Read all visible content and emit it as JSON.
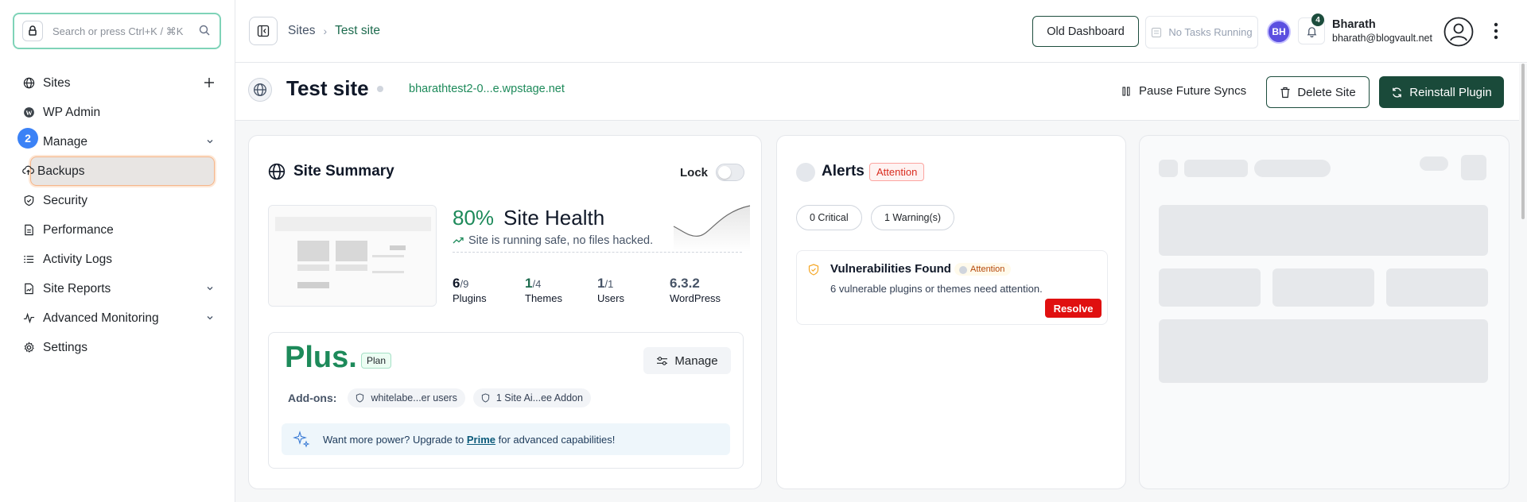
{
  "sidebar": {
    "search_placeholder": "Search or press Ctrl+K / ⌘K",
    "manage_step_badge": "2",
    "items": [
      {
        "label": "Sites",
        "icon": "globe-icon",
        "trail": "plus-icon"
      },
      {
        "label": "WP Admin",
        "icon": "wordpress-icon"
      },
      {
        "label": "Manage",
        "icon": "none",
        "trail": "chevron-down-icon"
      },
      {
        "label": "Backups",
        "icon": "cloud-upload-icon",
        "active": true
      },
      {
        "label": "Security",
        "icon": "shield-icon"
      },
      {
        "label": "Performance",
        "icon": "document-icon"
      },
      {
        "label": "Activity Logs",
        "icon": "list-icon"
      },
      {
        "label": "Site Reports",
        "icon": "file-report-icon",
        "trail": "chevron-down-icon"
      },
      {
        "label": "Advanced Monitoring",
        "icon": "pulse-icon",
        "trail": "chevron-down-icon"
      },
      {
        "label": "Settings",
        "icon": "gear-icon"
      }
    ]
  },
  "topbar": {
    "breadcrumb_root": "Sites",
    "breadcrumb_sep": "›",
    "breadcrumb_current": "Test site",
    "old_dashboard": "Old Dashboard",
    "tasks": "No Tasks Running",
    "avatar_initials": "BH",
    "notification_count": "4",
    "user_name": "Bharath",
    "user_email": "bharath@blogvault.net"
  },
  "site": {
    "title": "Test site",
    "url": "bharathtest2-0...e.wpstage.net",
    "pause": "Pause Future Syncs",
    "delete": "Delete Site",
    "reinstall": "Reinstall Plugin"
  },
  "summary": {
    "title": "Site Summary",
    "lock": "Lock",
    "lock_on": false,
    "health_pct": "80%",
    "health_label": "Site Health",
    "health_sub": "Site is running safe, no files hacked.",
    "stats": [
      {
        "num": "6",
        "den": "/9",
        "label": "Plugins"
      },
      {
        "num": "1",
        "den": "/4",
        "label": "Themes"
      },
      {
        "num": "1",
        "den": "/1",
        "label": "Users"
      },
      {
        "num": "6.3.2",
        "den": "",
        "label": "WordPress"
      }
    ],
    "plan_name": "Plus.",
    "plan_tag": "Plan",
    "manage": "Manage",
    "addons_label": "Add-ons:",
    "addons": [
      "whitelabe...er users",
      "1 Site Ai...ee Addon"
    ],
    "upgrade_prefix": "Want more power? Upgrade to ",
    "upgrade_link": "Prime",
    "upgrade_suffix": " for advanced capabilities!"
  },
  "alerts": {
    "title": "Alerts",
    "badge": "Attention",
    "critical": "0 Critical",
    "warnings": "1 Warning(s)",
    "vuln_title": "Vulnerabilities Found",
    "vuln_tag": "Attention",
    "vuln_desc": "6 vulnerable plugins or themes need attention.",
    "resolve": "Resolve"
  },
  "colors": {
    "brand_dark": "#1a4a3a",
    "brand_green": "#1d8a5a",
    "danger": "#e01010"
  }
}
